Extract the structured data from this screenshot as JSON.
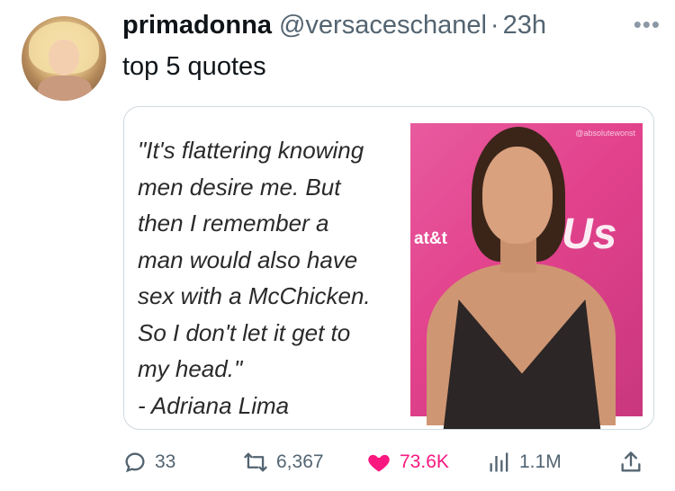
{
  "author": {
    "display_name": "primadonna",
    "handle": "@versaceschanel",
    "separator": "·",
    "time": "23h"
  },
  "tweet": {
    "text": "top 5 quotes"
  },
  "media": {
    "quote_text": "\"It's flattering knowing\nmen desire me. But\nthen I remember a\nman would also have\nsex with a McChicken.\nSo I don't let it get to\nmy head.\"\n- Adriana Lima",
    "photo_text_att": "at&t",
    "photo_text_us": "Us",
    "watermark": "@absolutewonst"
  },
  "actions": {
    "replies": "33",
    "reposts": "6,367",
    "likes": "73.6K",
    "views": "1.1M"
  },
  "colors": {
    "like": "#f91880",
    "muted": "#536471",
    "photo_bg": "#e2428c"
  },
  "icons": {
    "reply": "speech-bubble-icon",
    "repost": "repost-arrows-icon",
    "like": "heart-icon",
    "views": "bar-chart-icon",
    "share": "share-upload-icon",
    "more": "ellipsis-icon"
  }
}
